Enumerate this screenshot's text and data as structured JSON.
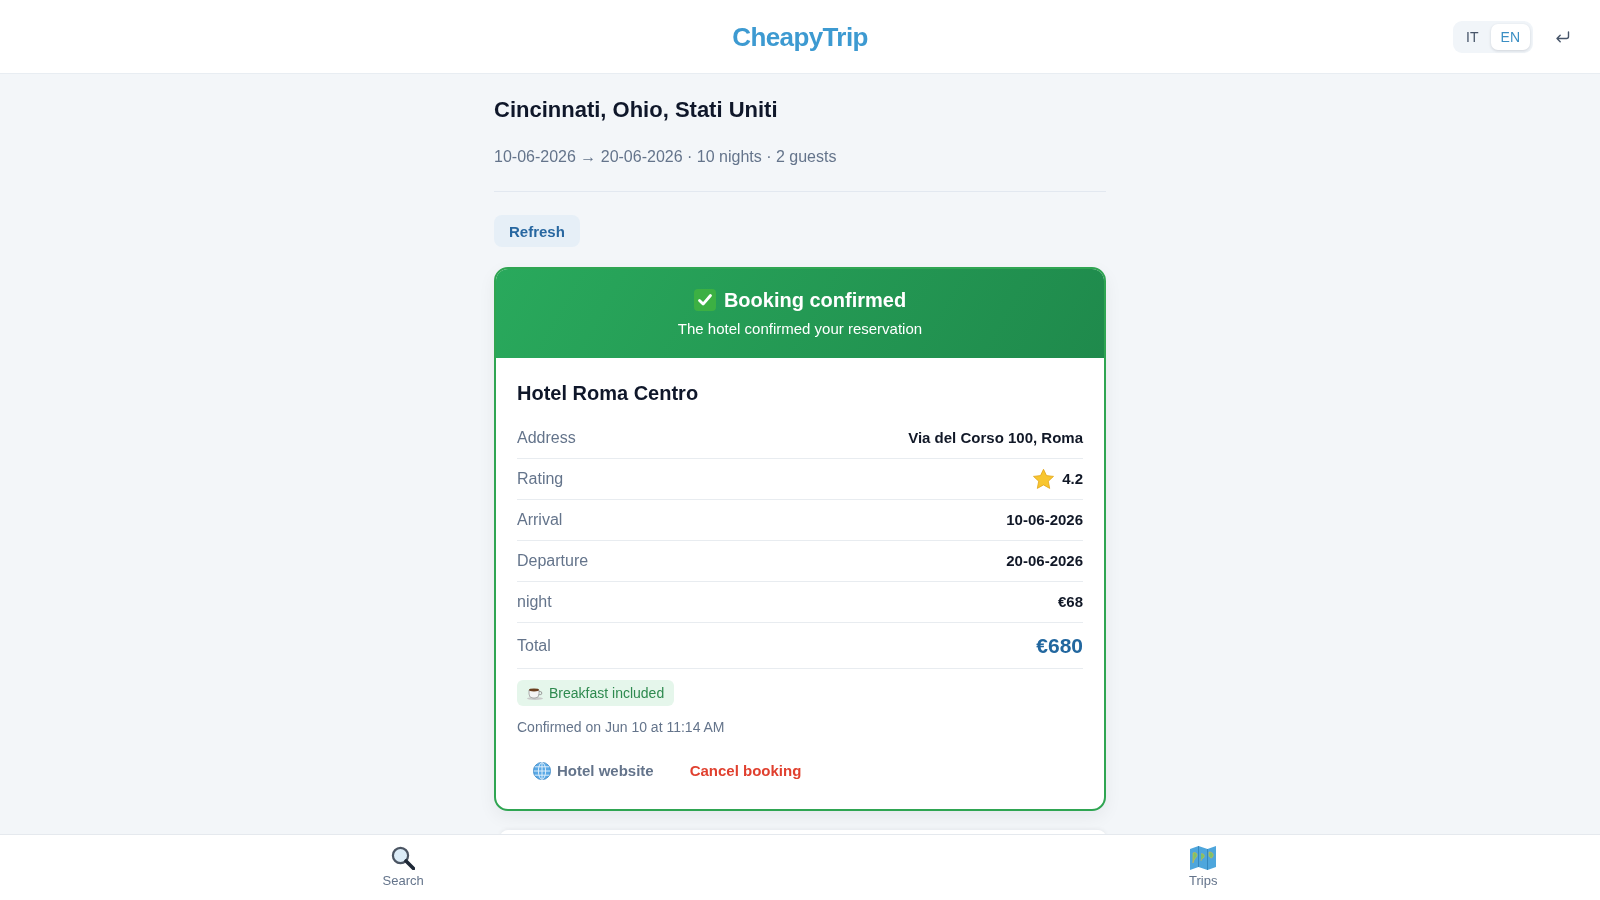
{
  "header": {
    "logo": "CheapyTrip",
    "languages": [
      {
        "label": "IT",
        "selected": false
      },
      {
        "label": "EN",
        "selected": true
      }
    ]
  },
  "trip": {
    "title": "Cincinnati, Ohio, Stati Uniti",
    "summary": "10-06-2026 → 20-06-2026 · 10 nights · 2 guests"
  },
  "refresh_button": "Refresh",
  "booking": {
    "status": {
      "title": "Booking confirmed",
      "message": "The hotel confirmed your reservation"
    },
    "hotel_name": "Hotel Roma Centro",
    "details": [
      {
        "label": "Address",
        "value": "Via del Corso 100, Roma",
        "kind": "text"
      },
      {
        "label": "Rating",
        "value": "4.2",
        "kind": "rating"
      },
      {
        "label": "Arrival",
        "value": "10-06-2026",
        "kind": "text"
      },
      {
        "label": "Departure",
        "value": "20-06-2026",
        "kind": "text"
      },
      {
        "label": "night",
        "value": "€68",
        "kind": "text"
      },
      {
        "label": "Total",
        "value": "€680",
        "kind": "total"
      }
    ],
    "amenities": [
      "Breakfast included"
    ],
    "confirmed_at": "Confirmed on Jun 10 at 11:14 AM",
    "actions": [
      {
        "label": "Hotel website",
        "kind": "link"
      },
      {
        "label": "Cancel booking",
        "kind": "danger"
      }
    ]
  },
  "bottom_nav": [
    {
      "label": "Search"
    },
    {
      "label": "Trips"
    }
  ]
}
